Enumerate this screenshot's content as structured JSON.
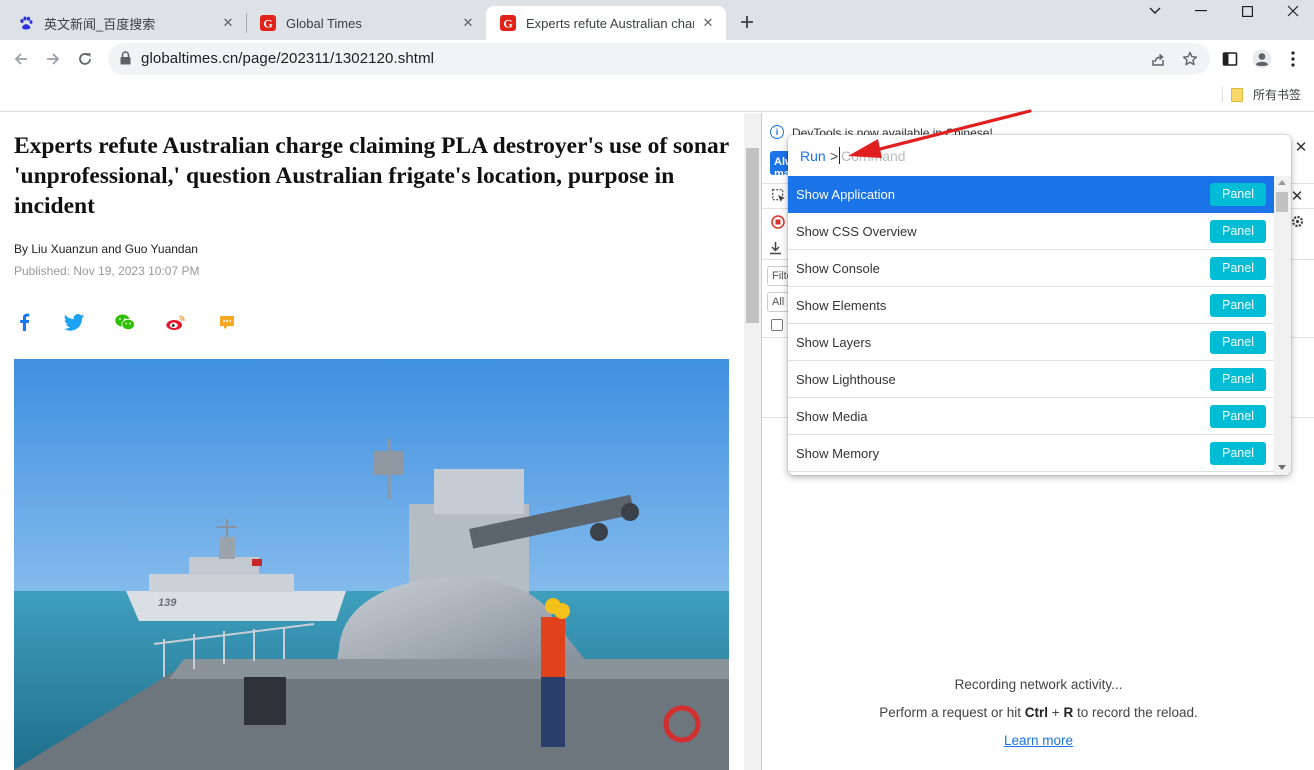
{
  "colors": {
    "accent": "#1a73e8",
    "panel_badge": "#00bcd4",
    "annotation_arrow": "#e02020",
    "globaltimes_red": "#e2231a",
    "baidu_blue": "#2932e1"
  },
  "tabs": [
    {
      "title": "英文新闻_百度搜索",
      "favicon": "baidu-paw-icon"
    },
    {
      "title": "Global Times",
      "favicon": "globaltimes-g-icon"
    },
    {
      "title": "Experts refute Australian charge claiming PLA destroyer's use of sonar",
      "favicon": "globaltimes-g-icon",
      "active": true
    }
  ],
  "toolbar": {
    "url": "globaltimes.cn/page/202311/1302120.shtml"
  },
  "bookmarks": {
    "folder_label": "所有书签"
  },
  "article": {
    "headline": "Experts refute Australian charge claiming PLA destroyer's use of sonar 'unprofessional,' question Australian frigate's location, purpose in incident",
    "byline": "By Liu Xuanzun and Guo Yuandan",
    "published": "Published: Nov 19, 2023 10:07 PM",
    "share_icons": [
      "facebook-icon",
      "twitter-icon",
      "wechat-icon",
      "weibo-icon",
      "comment-icon"
    ],
    "ship_hull_number": "139"
  },
  "devtools": {
    "info_text": "DevTools is now available in Chinese!",
    "blue_button_text": "Always match Chrome's language",
    "filter_placeholder": "Filter",
    "all_label": "All",
    "empty_line1": "Recording network activity...",
    "empty_line2_pre": "Perform a request or hit ",
    "empty_key1": "Ctrl",
    "empty_plus": " + ",
    "empty_key2": "R",
    "empty_line2_post": " to record the reload.",
    "learn_more": "Learn more"
  },
  "command_menu": {
    "run_label": "Run",
    "prompt": ">",
    "placeholder": "Command",
    "items": [
      {
        "label": "Show Application",
        "badge": "Panel",
        "selected": true
      },
      {
        "label": "Show CSS Overview",
        "badge": "Panel"
      },
      {
        "label": "Show Console",
        "badge": "Panel"
      },
      {
        "label": "Show Elements",
        "badge": "Panel"
      },
      {
        "label": "Show Layers",
        "badge": "Panel"
      },
      {
        "label": "Show Lighthouse",
        "badge": "Panel"
      },
      {
        "label": "Show Media",
        "badge": "Panel"
      },
      {
        "label": "Show Memory",
        "badge": "Panel"
      }
    ]
  }
}
